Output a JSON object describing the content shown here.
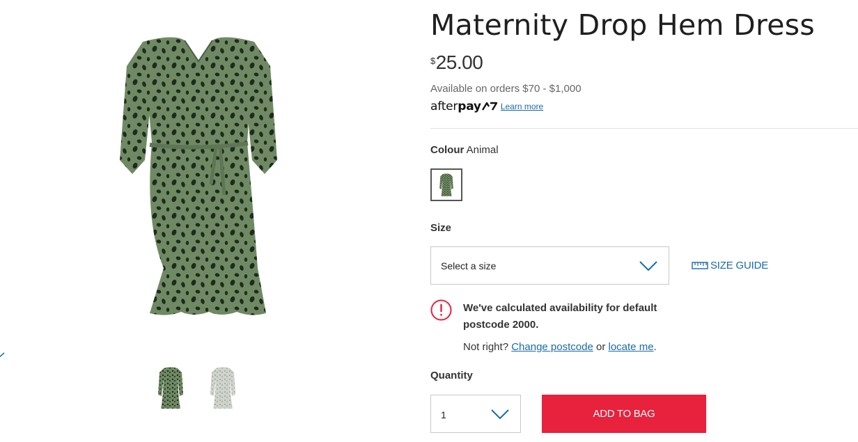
{
  "product": {
    "title": "Maternity Drop Hem Dress",
    "price_currency": "$",
    "price_value": "25.00"
  },
  "afterpay": {
    "availability": "Available on orders $70 - $1,000",
    "logo_text": "afterpay",
    "learn_more": "Learn more"
  },
  "colour": {
    "label": "Colour",
    "value": "Animal"
  },
  "size": {
    "label": "Size",
    "selected": "Select a size",
    "guide_label": "SIZE GUIDE"
  },
  "availability_notice": {
    "message": "We've calculated availability for default postcode 2000.",
    "prompt": "Not right?",
    "change_postcode": "Change postcode",
    "or": "or",
    "locate_me": "locate me",
    "end": "."
  },
  "quantity": {
    "label": "Quantity",
    "value": "1"
  },
  "add_to_bag": "ADD TO BAG",
  "colors": {
    "accent_blue": "#1a6aa8",
    "add_button_red": "#e8213c",
    "alert_red": "#e8213c",
    "dress_green": "#6f8a63"
  }
}
